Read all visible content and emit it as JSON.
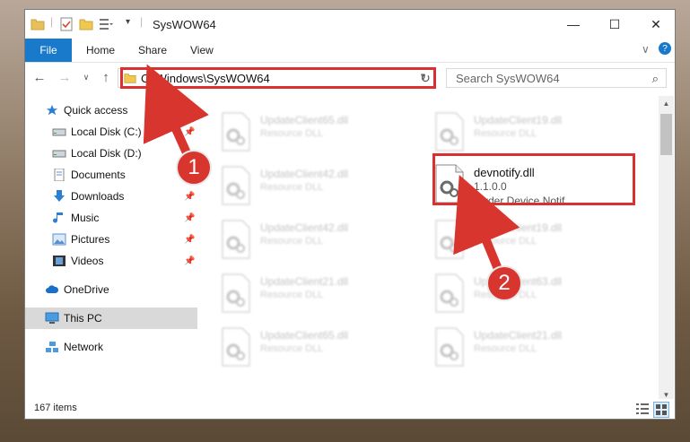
{
  "window": {
    "title": "SysWOW64",
    "controls": {
      "minimize": "—",
      "maximize": "☐",
      "close": "✕"
    }
  },
  "ribbon": {
    "tabs": [
      "File",
      "Home",
      "Share",
      "View"
    ],
    "expand": "∨",
    "help": "?"
  },
  "nav": {
    "back": "←",
    "forward": "→",
    "recent": "∨",
    "up": "↑",
    "address": "C:\\Windows\\SysWOW64",
    "address_dropdown": "∨",
    "refresh": "↻",
    "search_placeholder": "Search SysWOW64",
    "search_icon": "⌕"
  },
  "sidebar": {
    "items": [
      {
        "label": "Quick access",
        "icon": "star-icon",
        "pinned": false
      },
      {
        "label": "Local Disk (C:)",
        "icon": "drive-icon",
        "pinned": true
      },
      {
        "label": "Local Disk (D:)",
        "icon": "drive-icon",
        "pinned": false
      },
      {
        "label": "Documents",
        "icon": "documents-icon",
        "pinned": false
      },
      {
        "label": "Downloads",
        "icon": "downloads-icon",
        "pinned": true
      },
      {
        "label": "Music",
        "icon": "music-icon",
        "pinned": true
      },
      {
        "label": "Pictures",
        "icon": "pictures-icon",
        "pinned": true
      },
      {
        "label": "Videos",
        "icon": "videos-icon",
        "pinned": true
      },
      {
        "label": "OneDrive",
        "icon": "cloud-icon",
        "pinned": false
      },
      {
        "label": "This PC",
        "icon": "pc-icon",
        "pinned": false,
        "selected": true
      },
      {
        "label": "Network",
        "icon": "network-icon",
        "pinned": false
      }
    ],
    "pin_glyph": "📌"
  },
  "files": [
    {
      "name": "UpdateClient65.dll",
      "sub": "Resource DLL"
    },
    {
      "name": "UpdateClient19.dll",
      "sub": "Resource DLL"
    },
    {
      "name": "UpdateClient42.dll",
      "sub": "Resource DLL"
    },
    {
      "name": "devnotify.dll",
      "sub": "1.1.0.0",
      "desc": "Girder Device Notif...",
      "highlighted": true
    },
    {
      "name": "UpdateClient42.dll",
      "sub": "Resource DLL"
    },
    {
      "name": "UpdateClient19.dll",
      "sub": "Resource DLL"
    },
    {
      "name": "UpdateClient21.dll",
      "sub": "Resource DLL"
    },
    {
      "name": "UpdateClient63.dll",
      "sub": "Resource DLL"
    },
    {
      "name": "UpdateClient65.dll",
      "sub": "Resource DLL"
    },
    {
      "name": "UpdateClient21.dll",
      "sub": "Resource DLL"
    }
  ],
  "status": {
    "items": "167 items"
  },
  "annotations": {
    "step1": "1",
    "step2": "2"
  },
  "colors": {
    "accent": "#1979ca",
    "highlight": "#dc2f2f",
    "selected": "#d9d9d9"
  }
}
